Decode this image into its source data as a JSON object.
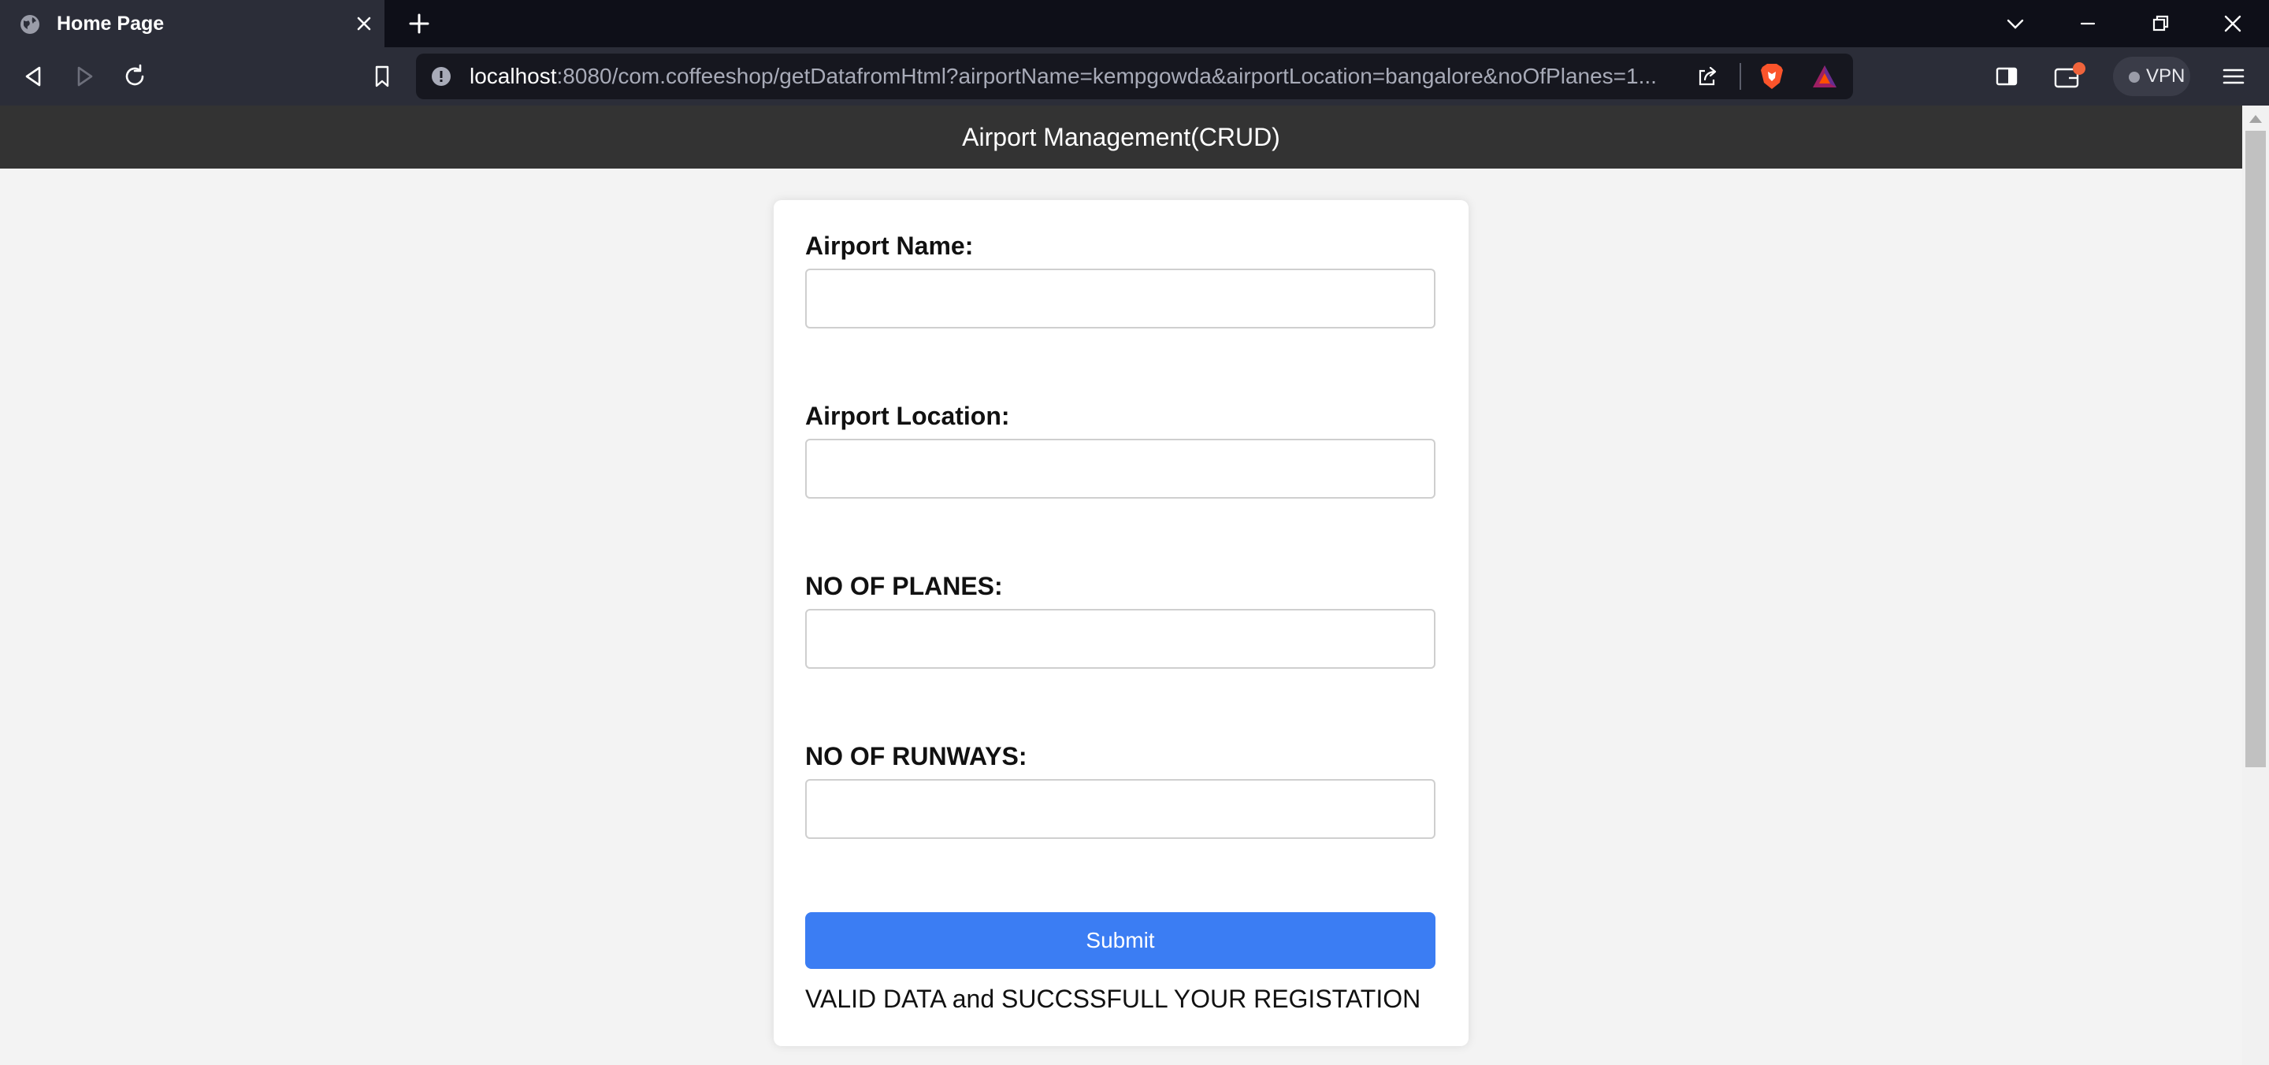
{
  "browser": {
    "tab": {
      "title": "Home Page"
    },
    "address": {
      "host": "localhost",
      "path": ":8080/com.coffeeshop/getDatafromHtml?airportName=kempgowda&airportLocation=bangalore&noOfPlanes=1..."
    },
    "vpn_label": "VPN",
    "colors": {
      "tabbar": "#0e0f18",
      "toolbar": "#2b2d38",
      "urlbar": "#16171f",
      "wallet_badge": "#f0643c"
    }
  },
  "header": {
    "title": "Airport Management(CRUD)"
  },
  "form": {
    "fields": [
      {
        "label": "Airport Name:",
        "value": ""
      },
      {
        "label": "Airport Location:",
        "value": ""
      },
      {
        "label": "NO OF PLANES:",
        "value": ""
      },
      {
        "label": "NO OF RUNWAYS:",
        "value": ""
      }
    ],
    "submit_label": "Submit",
    "message": "VALID DATA and SUCCSSFULL YOUR REGISTATION"
  },
  "colors": {
    "header_bg": "#333333",
    "page_bg": "#f3f3f3",
    "button": "#3b7df3"
  },
  "icons": [
    "globe-icon",
    "close-icon",
    "plus-icon",
    "chevron-down-icon",
    "minimize-icon",
    "restore-icon",
    "back-icon",
    "forward-icon",
    "reload-icon",
    "bookmark-icon",
    "info-icon",
    "share-icon",
    "brave-shields-icon",
    "brave-rewards-icon",
    "sidebar-icon",
    "wallet-icon",
    "hamburger-menu-icon"
  ]
}
